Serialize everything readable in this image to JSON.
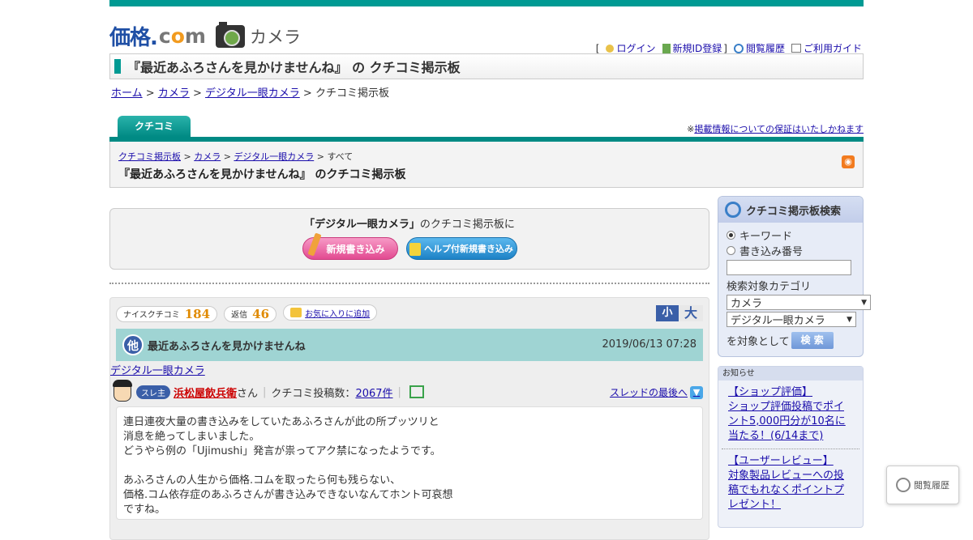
{
  "header": {
    "logo_main": "価格.",
    "logo_com_c": "c",
    "logo_com_o": "o",
    "logo_com_m": "m",
    "logo_section": "カメラ",
    "bracket_open": "[",
    "bracket_close": "]",
    "links": [
      "ログイン",
      "新規ID登録",
      "閲覧履歴",
      "ご利用ガイド"
    ]
  },
  "page_title": "『最近あふろさんを見かけませんね』 の クチコミ掲示板",
  "breadcrumb": {
    "items": [
      "ホーム",
      "カメラ",
      "デジタル一眼カメラ"
    ],
    "current": "クチコミ掲示板",
    "sep": ">"
  },
  "tab": {
    "label": "クチコミ"
  },
  "disclaimer": {
    "prefix": "※",
    "link": "掲載情報についての保証はいたしかねます"
  },
  "sub_panel": {
    "bc": [
      "クチコミ掲示板",
      "カメラ",
      "デジタル一眼カメラ"
    ],
    "bc_current": "すべて",
    "title": "『最近あふろさんを見かけませんね』 のクチコミ掲示板",
    "rss": "RSS"
  },
  "post_box": {
    "lead_bold": "「デジタル一眼カメラ」",
    "lead_rest": "のクチコミ掲示板に",
    "new_post": "新規書き込み",
    "help_post": "ヘルプ付新規書き込み"
  },
  "thread": {
    "nice_label": "ナイスクチコミ",
    "nice_count": "184",
    "reply_label": "返信",
    "reply_count": "46",
    "fav_label": "お気に入りに追加",
    "size_small": "小",
    "size_large": "大",
    "badge": "他",
    "title": "最近あふろさんを見かけませんね",
    "date": "2019/06/13 07:28",
    "category": "デジタル一眼カメラ",
    "author_badge": "スレ主",
    "author_name": "浜松屋飲兵衛",
    "author_suffix": "さん",
    "post_count_label": "クチコミ投稿数：",
    "post_count": "2067件",
    "last_link": "スレッドの最後へ",
    "body": "連日連夜大量の書き込みをしていたあふろさんが此の所プッツリと\n消息を絶ってしまいました。\nどうやら例の「Ujimushi」発言が祟ってアク禁になったようです。\n\nあふろさんの人生から価格.コムを取ったら何も残らない、\n価格.コム依存症のあふろさんが書き込みできないなんてホント可哀想\nですね。"
  },
  "search": {
    "title": "クチコミ掲示板検索",
    "radio_keyword": "キーワード",
    "radio_number": "書き込み番号",
    "keyword_value": "",
    "category_label": "検索対象カテゴリ",
    "select1": "カメラ",
    "select2": "デジタル一眼カメラ",
    "target_label": "を対象として",
    "button": "検 索"
  },
  "notice": {
    "head": "お知らせ",
    "items": [
      {
        "title": "【ショップ評価】",
        "text": "ショップ評価投稿でポイント5,000円分が10名に当たる！(6/14まで)"
      },
      {
        "title": "【ユーザーレビュー】",
        "text": "対象製品レビューへの投稿でもれなくポイントプレゼント！"
      }
    ]
  },
  "history_float": {
    "label": "閲覧履歴"
  },
  "colors": {
    "brand": "#009a93",
    "accent_blue": "#3a5fa8",
    "thread_header": "#9fd4d3"
  }
}
